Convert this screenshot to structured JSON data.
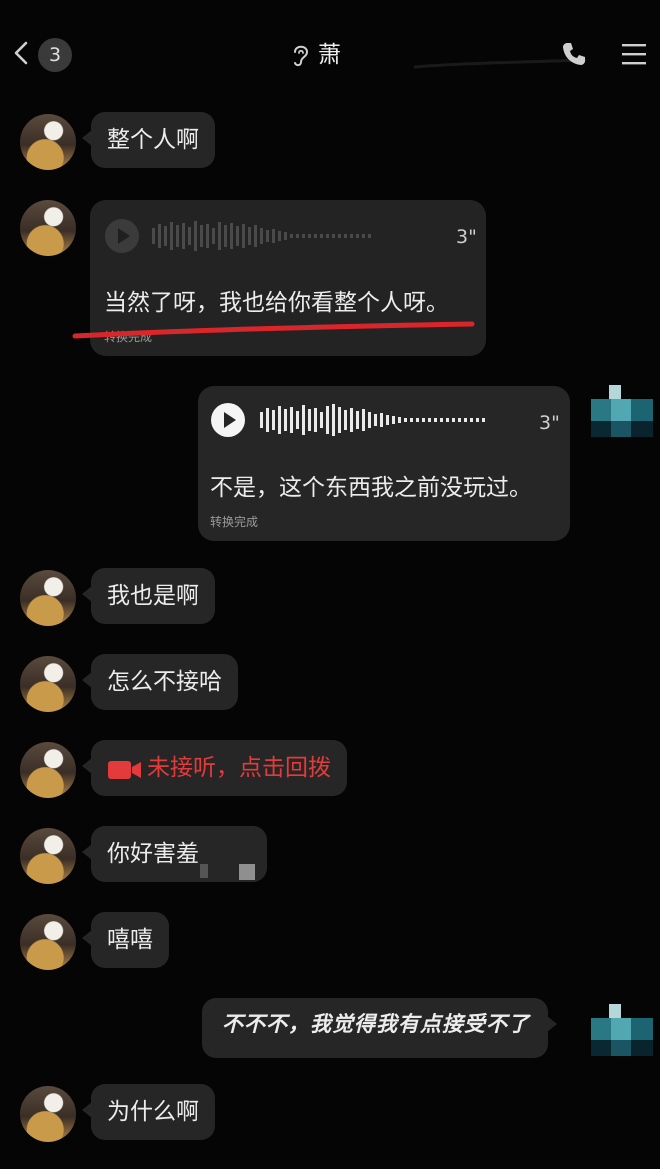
{
  "header": {
    "unread_count": "3",
    "contact_name": "萧"
  },
  "messages": [
    {
      "side": "left",
      "type": "text",
      "text": "整个人啊"
    },
    {
      "side": "left",
      "type": "voice",
      "duration": "3\"",
      "transcript": "当然了呀，我也给你看整个人呀。",
      "status": "转换完成"
    },
    {
      "side": "right",
      "type": "voice",
      "duration": "3\"",
      "transcript": "不是，这个东西我之前没玩过。",
      "status": "转换完成"
    },
    {
      "side": "left",
      "type": "text",
      "text": "我也是啊"
    },
    {
      "side": "left",
      "type": "text",
      "text": "怎么不接哈"
    },
    {
      "side": "left",
      "type": "missed_call",
      "text": "未接听，点击回拨"
    },
    {
      "side": "left",
      "type": "text",
      "text": "你好害羞"
    },
    {
      "side": "left",
      "type": "text",
      "text": "嘻嘻"
    },
    {
      "side": "right",
      "type": "text",
      "text": "不不不，我觉得我有点接受不了"
    },
    {
      "side": "left",
      "type": "text",
      "text": "为什么啊"
    }
  ],
  "colors": {
    "background": "#050505",
    "bubble": "#262626",
    "missed_call": "#e33b3b",
    "annotation_underline": "#d9262b"
  },
  "icons": {
    "back": "chevron-left-icon",
    "voice_mode": "ear-icon",
    "call": "phone-icon",
    "more": "menu-icon",
    "play": "play-icon",
    "video_call": "video-camera-icon"
  }
}
